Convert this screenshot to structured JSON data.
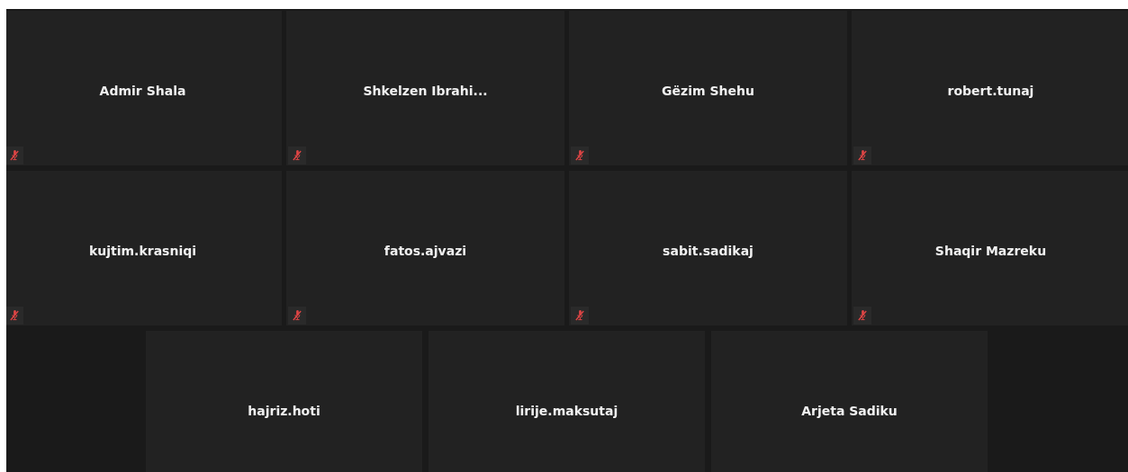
{
  "rows": [
    {
      "tiles": [
        {
          "name": "Admir Shala",
          "muted": true
        },
        {
          "name": "Shkelzen  Ibrahi...",
          "muted": true
        },
        {
          "name": "Gëzim Shehu",
          "muted": true
        },
        {
          "name": "robert.tunaj",
          "muted": true
        }
      ]
    },
    {
      "tiles": [
        {
          "name": "kujtim.krasniqi",
          "muted": true
        },
        {
          "name": "fatos.ajvazi",
          "muted": true
        },
        {
          "name": "sabit.sadikaj",
          "muted": true
        },
        {
          "name": "Shaqir Mazreku",
          "muted": true
        }
      ]
    },
    {
      "tiles": [
        {
          "name": "hajriz.hoti"
        },
        {
          "name": "lirije.maksutaj"
        },
        {
          "name": "Arjeta Sadiku"
        }
      ]
    }
  ]
}
